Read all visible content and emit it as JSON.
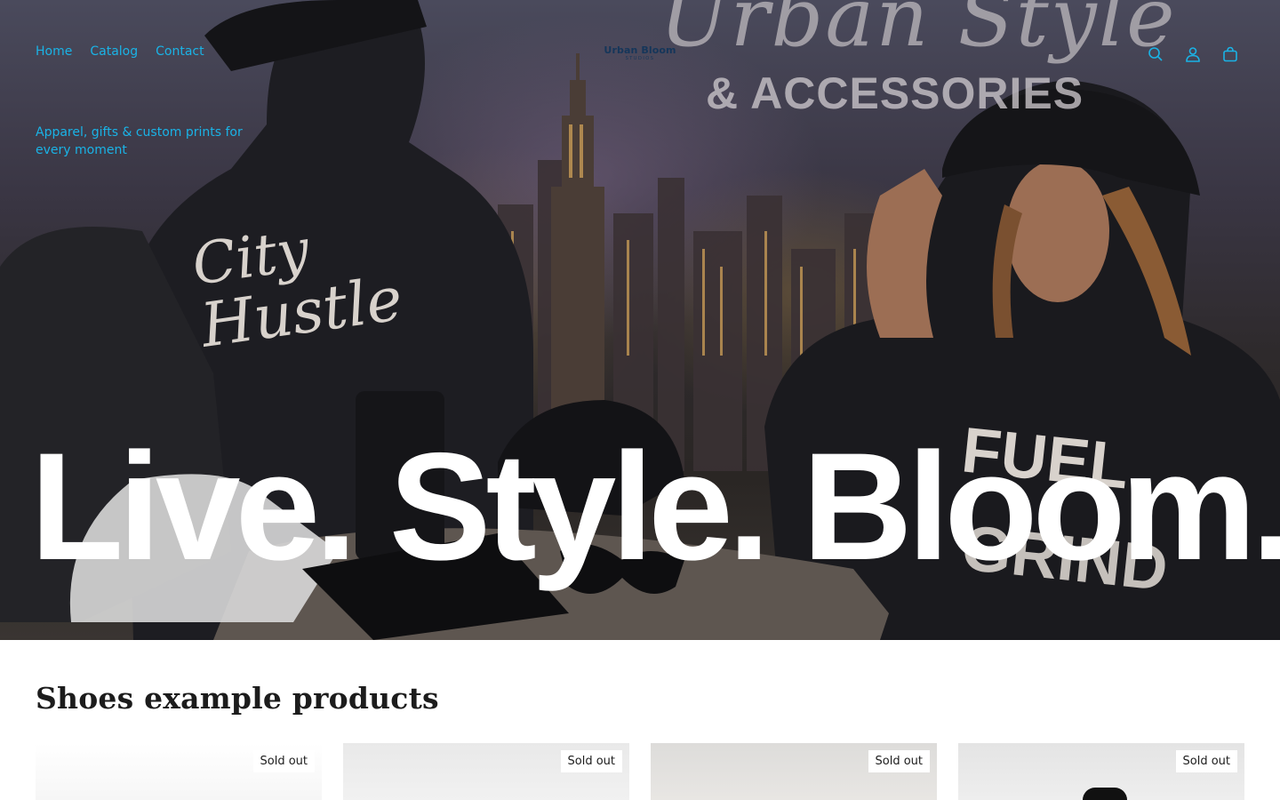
{
  "nav": {
    "items": [
      {
        "label": "Home"
      },
      {
        "label": "Catalog"
      },
      {
        "label": "Contact"
      }
    ]
  },
  "logo": {
    "main": "Urban Bloom",
    "sub": "STUDIOS"
  },
  "header_icons": [
    "search-icon",
    "account-icon",
    "cart-icon"
  ],
  "hero": {
    "tagline": "Apparel, gifts & custom prints for every moment",
    "headline": "Live. Style. Bloom.",
    "wall_script": "Urban Style",
    "wall_caps": "& ACCESSORIES"
  },
  "products_section": {
    "title": "Shoes example products",
    "cards": [
      {
        "badge": "Sold out"
      },
      {
        "badge": "Sold out"
      },
      {
        "badge": "Sold out"
      },
      {
        "badge": "Sold out"
      }
    ]
  },
  "colors": {
    "accent": "#1ab3e6",
    "logo": "#15365a",
    "headline": "#ffffff",
    "section_title": "#1c1c1c"
  }
}
